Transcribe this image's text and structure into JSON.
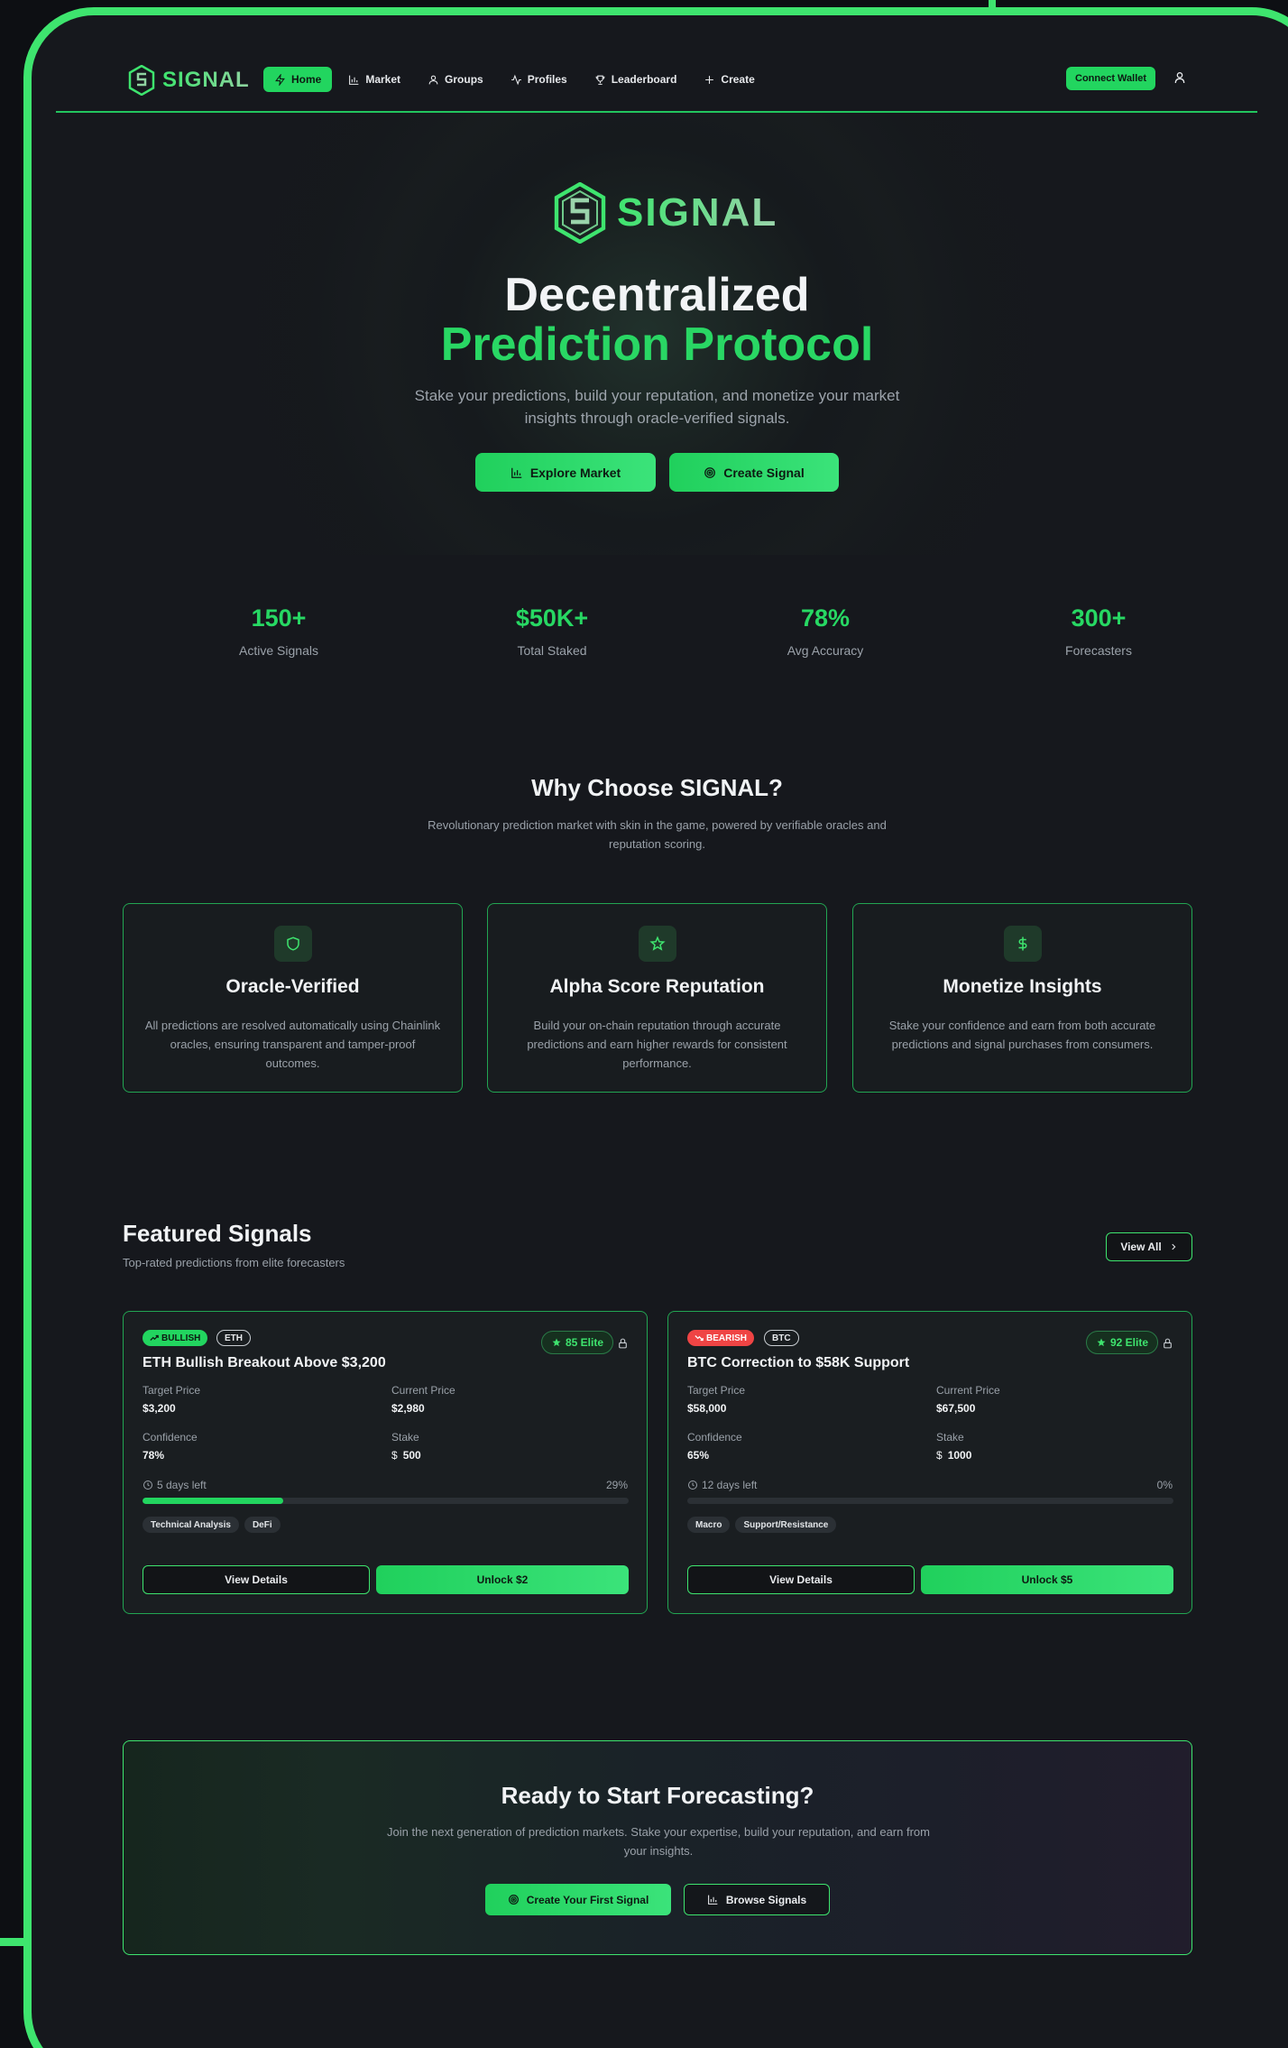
{
  "brand": {
    "name": "SIGNAL"
  },
  "nav": {
    "items": [
      {
        "label": "Home",
        "icon": "bolt-icon",
        "active": true
      },
      {
        "label": "Market",
        "icon": "bar-chart-icon"
      },
      {
        "label": "Groups",
        "icon": "user-icon"
      },
      {
        "label": "Profiles",
        "icon": "activity-icon"
      },
      {
        "label": "Leaderboard",
        "icon": "trophy-icon"
      },
      {
        "label": "Create",
        "icon": "plus-icon"
      }
    ],
    "connect_label": "Connect Wallet"
  },
  "hero": {
    "logo_text": "SIGNAL",
    "title_line1": "Decentralized",
    "title_line2": "Prediction Protocol",
    "subtitle": "Stake your predictions, build your reputation, and monetize your market insights through oracle-verified signals.",
    "explore_label": "Explore Market",
    "create_label": "Create Signal"
  },
  "stats": [
    {
      "value": "150+",
      "label": "Active Signals"
    },
    {
      "value": "$50K+",
      "label": "Total Staked"
    },
    {
      "value": "78%",
      "label": "Avg Accuracy"
    },
    {
      "value": "300+",
      "label": "Forecasters"
    }
  ],
  "why": {
    "title": "Why Choose SIGNAL?",
    "subtitle": "Revolutionary prediction market with skin in the game, powered by verifiable oracles and reputation scoring.",
    "features": [
      {
        "icon": "shield-icon",
        "title": "Oracle-Verified",
        "desc": "All predictions are resolved automatically using Chainlink oracles, ensuring transparent and tamper-proof outcomes."
      },
      {
        "icon": "star-icon",
        "title": "Alpha Score Reputation",
        "desc": "Build your on-chain reputation through accurate predictions and earn higher rewards for consistent performance."
      },
      {
        "icon": "dollar-icon",
        "title": "Monetize Insights",
        "desc": "Stake your confidence and earn from both accurate predictions and signal purchases from consumers."
      }
    ]
  },
  "featured": {
    "title": "Featured Signals",
    "subtitle": "Top-rated predictions from elite forecasters",
    "view_all_label": "View All",
    "signals": [
      {
        "direction": "BULLISH",
        "asset": "ETH",
        "elite": "85 Elite",
        "title": "ETH Bullish Breakout Above $3,200",
        "target_label": "Target Price",
        "target": "$3,200",
        "current_label": "Current Price",
        "current": "$2,980",
        "confidence_label": "Confidence",
        "confidence": "78%",
        "stake_label": "Stake",
        "stake": "500",
        "time_left": "5 days left",
        "progress_text": "29%",
        "progress": 0.29,
        "tags": [
          "Technical Analysis",
          "DeFi"
        ],
        "details_label": "View Details",
        "unlock_label": "Unlock $2"
      },
      {
        "direction": "BEARISH",
        "asset": "BTC",
        "elite": "92 Elite",
        "title": "BTC Correction to $58K Support",
        "target_label": "Target Price",
        "target": "$58,000",
        "current_label": "Current Price",
        "current": "$67,500",
        "confidence_label": "Confidence",
        "confidence": "65%",
        "stake_label": "Stake",
        "stake": "1000",
        "time_left": "12 days left",
        "progress_text": "0%",
        "progress": 0.0,
        "tags": [
          "Macro",
          "Support/Resistance"
        ],
        "details_label": "View Details",
        "unlock_label": "Unlock $5"
      }
    ]
  },
  "cta": {
    "title": "Ready to Start Forecasting?",
    "subtitle": "Join the next generation of prediction markets. Stake your expertise, build your reputation, and earn from your insights.",
    "primary_label": "Create Your First Signal",
    "secondary_label": "Browse Signals"
  },
  "colors": {
    "accent": "#22d55f",
    "bear": "#ef4444",
    "bg": "#16181d"
  }
}
